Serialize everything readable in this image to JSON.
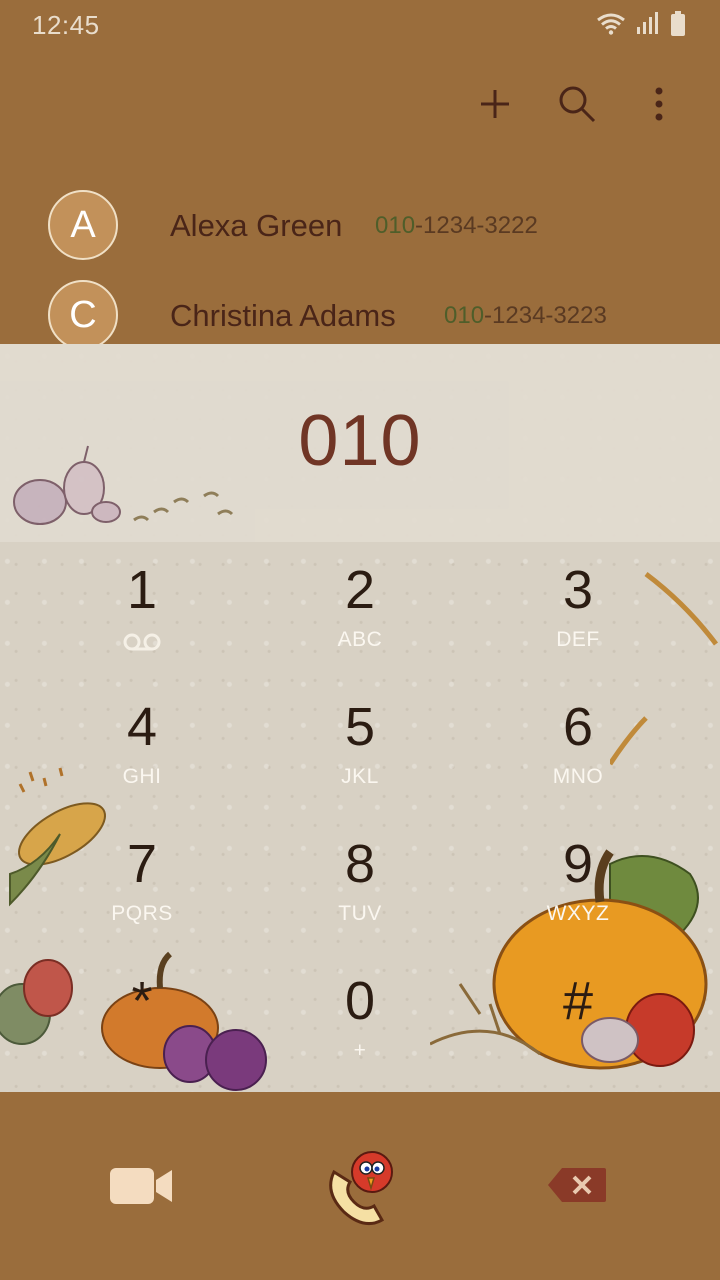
{
  "status": {
    "time": "12:45"
  },
  "toolbar": {
    "icons": [
      "add-icon",
      "search-icon",
      "more-options-icon"
    ]
  },
  "contacts": [
    {
      "initial": "A",
      "name": "Alexa Green",
      "number_match": "010",
      "number_rest": "-1234-3222"
    },
    {
      "initial": "C",
      "name": "Christina Adams",
      "number_match": "010",
      "number_rest": "-1234-3223"
    }
  ],
  "dial": {
    "value": "010"
  },
  "keypad": [
    {
      "digit": "1",
      "letters": ""
    },
    {
      "digit": "2",
      "letters": "ABC"
    },
    {
      "digit": "3",
      "letters": "DEF"
    },
    {
      "digit": "4",
      "letters": "GHI"
    },
    {
      "digit": "5",
      "letters": "JKL"
    },
    {
      "digit": "6",
      "letters": "MNO"
    },
    {
      "digit": "7",
      "letters": "PQRS"
    },
    {
      "digit": "8",
      "letters": "TUV"
    },
    {
      "digit": "9",
      "letters": "WXYZ"
    },
    {
      "digit": "*",
      "letters": ""
    },
    {
      "digit": "0",
      "letters": "+"
    },
    {
      "digit": "#",
      "letters": ""
    }
  ],
  "colors": {
    "header_bg": "#9a6d3c",
    "name_text": "#4a2518",
    "dial_text": "#6b2d1d",
    "match_text": "#4f5e2a"
  }
}
